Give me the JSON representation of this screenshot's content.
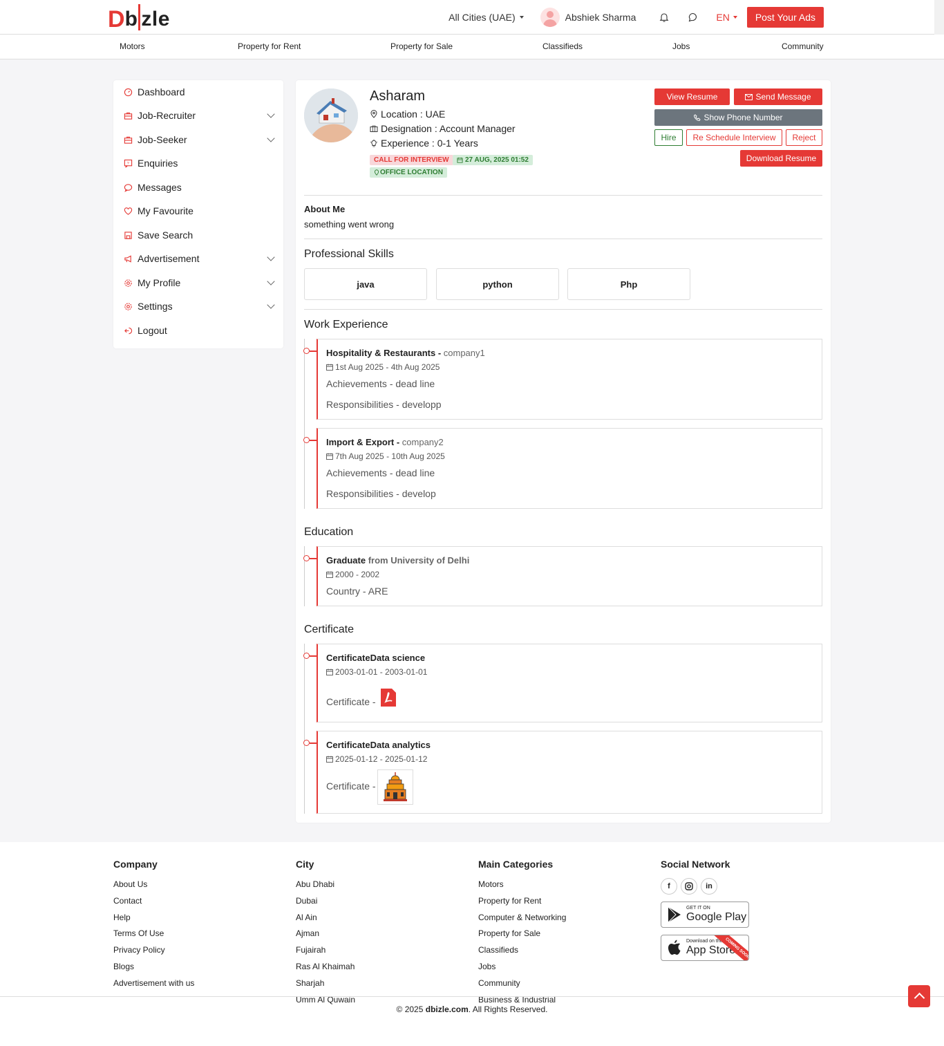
{
  "header": {
    "logo_d": "D",
    "logo_b": "b",
    "logo_rest": "zle",
    "city": "All Cities (UAE)",
    "user_name": "Abshiek Sharma",
    "lang": "EN",
    "post_ads": "Post Your Ads"
  },
  "nav": [
    "Motors",
    "Property for Rent",
    "Property for Sale",
    "Classifieds",
    "Jobs",
    "Community"
  ],
  "sidebar": {
    "items": [
      {
        "label": "Dashboard"
      },
      {
        "label": "Job-Recruiter"
      },
      {
        "label": "Job-Seeker"
      },
      {
        "label": "Enquiries"
      },
      {
        "label": "Messages"
      },
      {
        "label": "My Favourite"
      },
      {
        "label": "Save Search"
      },
      {
        "label": "Advertisement"
      },
      {
        "label": "My Profile"
      },
      {
        "label": "Settings"
      },
      {
        "label": "Logout"
      }
    ]
  },
  "profile": {
    "name": "Asharam",
    "location": "Location : UAE",
    "designation": "Designation : Account Manager",
    "experience": "Experience : 0-1 Years",
    "badge_status": "CALL FOR INTERVIEW",
    "badge_date": "27 AUG, 2025 01:52",
    "badge_location": "OFFICE LOCATION"
  },
  "actions": {
    "view_resume": "View Resume",
    "send_message": "Send Message",
    "show_phone": "Show Phone Number",
    "hire": "Hire",
    "reschedule": "Re Schedule Interview",
    "reject": "Reject",
    "download_resume": "Download Resume"
  },
  "about": {
    "title": "About Me",
    "text": "something went wrong"
  },
  "skills": {
    "title": "Professional Skills",
    "items": [
      "java",
      "python",
      "Php"
    ]
  },
  "work": {
    "title": "Work Experience",
    "items": [
      {
        "role": "Hospitality & Restaurants - ",
        "company": "company1",
        "dates": "1st Aug 2025 - 4th Aug 2025",
        "achievements": "Achievements - dead line",
        "responsibilities": "Responsibilities - developp"
      },
      {
        "role": "Import & Export - ",
        "company": "company2",
        "dates": "7th Aug 2025 - 10th Aug 2025",
        "achievements": "Achievements - dead line",
        "responsibilities": "Responsibilities - develop"
      }
    ]
  },
  "education": {
    "title": "Education",
    "items": [
      {
        "degree": "Graduate",
        "from": " from University of Delhi",
        "dates": "2000 - 2002",
        "country": "Country - ARE"
      }
    ]
  },
  "certificate": {
    "title": "Certificate",
    "items": [
      {
        "name": "CertificateData science",
        "dates": "2003-01-01 - 2003-01-01",
        "label": "Certificate - "
      },
      {
        "name": "CertificateData analytics",
        "dates": "2025-01-12 - 2025-01-12",
        "label": "Certificate - "
      }
    ]
  },
  "footer": {
    "company": {
      "title": "Company",
      "links": [
        "About Us",
        "Contact",
        "Help",
        "Terms Of Use",
        "Privacy Policy",
        "Blogs",
        "Advertisement with us"
      ]
    },
    "city": {
      "title": "City",
      "links": [
        "Abu Dhabi",
        "Dubai",
        "Al Ain",
        "Ajman",
        "Fujairah",
        "Ras Al Khaimah",
        "Sharjah",
        "Umm Al Quwain"
      ]
    },
    "categories": {
      "title": "Main Categories",
      "links": [
        "Motors",
        "Property for Rent",
        "Computer & Networking",
        "Property for Sale",
        "Classifieds",
        "Jobs",
        "Community",
        "Business & Industrial"
      ]
    },
    "social": {
      "title": "Social Network",
      "icons": [
        "facebook-icon",
        "instagram-icon",
        "linkedin-icon"
      ]
    },
    "google_small": "GET IT ON",
    "google_big": "Google Play",
    "apple_small": "Download on the",
    "apple_big": "App Store",
    "coming_soon": "COMING SOON",
    "copyright_pre": "© 2025 ",
    "copyright_site": "dbizle.com",
    "copyright_post": ". All Rights Reserved."
  },
  "colors": {
    "accent": "#e53935",
    "success": "#2e7d32",
    "muted_button": "#6c757d"
  }
}
